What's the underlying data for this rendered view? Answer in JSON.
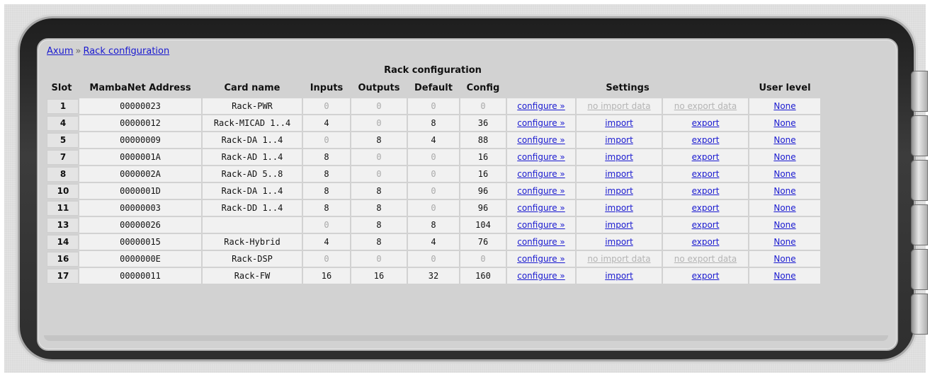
{
  "breadcrumb": {
    "root": "Axum",
    "separator": "»",
    "current": "Rack configuration"
  },
  "table": {
    "title": "Rack configuration",
    "headers": {
      "slot": "Slot",
      "address": "MambaNet Address",
      "card_name": "Card name",
      "inputs": "Inputs",
      "outputs": "Outputs",
      "default": "Default",
      "config": "Config",
      "settings": "Settings",
      "user_level": "User level"
    },
    "rows": [
      {
        "slot": "1",
        "address": "00000023",
        "card_name": "Rack-PWR",
        "inputs": "0",
        "outputs": "0",
        "default": "0",
        "config": "0",
        "configure": "configure »",
        "import": "no import data",
        "import_enabled": false,
        "export": "no export data",
        "export_enabled": false,
        "user_level": "None"
      },
      {
        "slot": "4",
        "address": "00000012",
        "card_name": "Rack-MICAD 1..4",
        "inputs": "4",
        "outputs": "0",
        "default": "8",
        "config": "36",
        "configure": "configure »",
        "import": "import",
        "import_enabled": true,
        "export": "export",
        "export_enabled": true,
        "user_level": "None"
      },
      {
        "slot": "5",
        "address": "00000009",
        "card_name": "Rack-DA 1..4",
        "inputs": "0",
        "outputs": "8",
        "default": "4",
        "config": "88",
        "configure": "configure »",
        "import": "import",
        "import_enabled": true,
        "export": "export",
        "export_enabled": true,
        "user_level": "None"
      },
      {
        "slot": "7",
        "address": "0000001A",
        "card_name": "Rack-AD 1..4",
        "inputs": "8",
        "outputs": "0",
        "default": "0",
        "config": "16",
        "configure": "configure »",
        "import": "import",
        "import_enabled": true,
        "export": "export",
        "export_enabled": true,
        "user_level": "None"
      },
      {
        "slot": "8",
        "address": "0000002A",
        "card_name": "Rack-AD 5..8",
        "inputs": "8",
        "outputs": "0",
        "default": "0",
        "config": "16",
        "configure": "configure »",
        "import": "import",
        "import_enabled": true,
        "export": "export",
        "export_enabled": true,
        "user_level": "None"
      },
      {
        "slot": "10",
        "address": "0000001D",
        "card_name": "Rack-DA 1..4",
        "inputs": "8",
        "outputs": "8",
        "default": "0",
        "config": "96",
        "configure": "configure »",
        "import": "import",
        "import_enabled": true,
        "export": "export",
        "export_enabled": true,
        "user_level": "None"
      },
      {
        "slot": "11",
        "address": "00000003",
        "card_name": "Rack-DD 1..4",
        "inputs": "8",
        "outputs": "8",
        "default": "0",
        "config": "96",
        "configure": "configure »",
        "import": "import",
        "import_enabled": true,
        "export": "export",
        "export_enabled": true,
        "user_level": "None"
      },
      {
        "slot": "13",
        "address": "00000026",
        "card_name": "",
        "inputs": "0",
        "outputs": "8",
        "default": "8",
        "config": "104",
        "configure": "configure »",
        "import": "import",
        "import_enabled": true,
        "export": "export",
        "export_enabled": true,
        "user_level": "None"
      },
      {
        "slot": "14",
        "address": "00000015",
        "card_name": "Rack-Hybrid",
        "inputs": "4",
        "outputs": "8",
        "default": "4",
        "config": "76",
        "configure": "configure »",
        "import": "import",
        "import_enabled": true,
        "export": "export",
        "export_enabled": true,
        "user_level": "None"
      },
      {
        "slot": "16",
        "address": "0000000E",
        "card_name": "Rack-DSP",
        "inputs": "0",
        "outputs": "0",
        "default": "0",
        "config": "0",
        "configure": "configure »",
        "import": "no import data",
        "import_enabled": false,
        "export": "no export data",
        "export_enabled": false,
        "user_level": "None"
      },
      {
        "slot": "17",
        "address": "00000011",
        "card_name": "Rack-FW",
        "inputs": "16",
        "outputs": "16",
        "default": "32",
        "config": "160",
        "configure": "configure »",
        "import": "import",
        "import_enabled": true,
        "export": "export",
        "export_enabled": true,
        "user_level": "None"
      }
    ]
  },
  "colors": {
    "link": "#1a1ad0",
    "dim_value": "#aaaaaa",
    "disabled_link": "#b4b4b4",
    "cell_bg": "#f1f1f1",
    "panel_bg": "#d2d2d2"
  }
}
